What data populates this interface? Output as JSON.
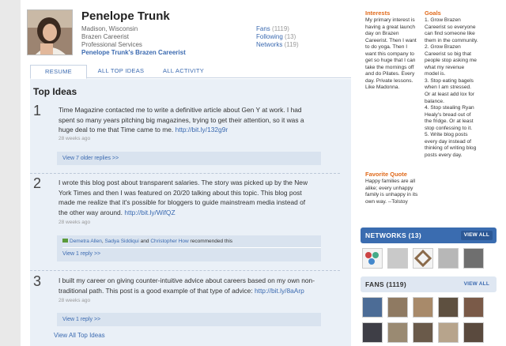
{
  "profile": {
    "name": "Penelope Trunk",
    "location": "Madison, Wisconsin",
    "company": "Brazen Careerist",
    "industry": "Professional Services",
    "blog_link": "Penelope Trunk's Brazen Careerist"
  },
  "stats": [
    {
      "label": "Fans",
      "count": "(1119)"
    },
    {
      "label": "Following",
      "count": "(13)"
    },
    {
      "label": "Networks",
      "count": "(119)"
    }
  ],
  "tabs": [
    "RESUME",
    "ALL TOP IDEAS",
    "ALL ACTIVITY"
  ],
  "section_title": "Top Ideas",
  "ideas": [
    {
      "num": "1",
      "text": "Time Magazine contacted me to write a definitive article about Gen Y at work. I had spent so many years pitching big magazines, trying to get their attention, so it was a huge deal to me that Time came to me.",
      "link": "http://bit.ly/132g9r",
      "ago": "28 weeks ago",
      "replies": "View 7 older replies >>"
    },
    {
      "num": "2",
      "text": "I wrote this blog post about transparent salaries. The story was picked up by the New York Times and then I was featured on 20/20 talking about this topic. This blog post made me realize that it's possible for bloggers to guide mainstream media instead of the other way around.",
      "link": "http://bit.ly/WifQZ",
      "ago": "28 weeks ago",
      "rec_names": [
        "Demetra Allen",
        "Sadya Siddiqui",
        "Christopher How"
      ],
      "rec_sep1": ",",
      "rec_and": "and",
      "rec_suffix": "recommended this",
      "replies": "View 1 reply >>"
    },
    {
      "num": "3",
      "text": "I built my career on giving counter-intuitive advice about careers based on my own non-traditional path. This post is a good example of that type of advice:",
      "link": "http://bit.ly/8aArp",
      "ago": "28 weeks ago",
      "replies": "View 1 reply >>"
    }
  ],
  "view_all_ideas": "View All Top Ideas",
  "interests": {
    "title": "Interests",
    "lines": [
      "My primary interest is",
      "having a great launch",
      "day on Brazen",
      "Careerist. Then I want",
      "to do yoga. Then I",
      "want this company to",
      "get so huge that I can",
      "take the mornings off",
      "and do Pilates. Every",
      "day. Private lessons.",
      "Like Madonna."
    ]
  },
  "goals": {
    "title": "Goals",
    "lines": [
      "1. Grow Brazen",
      "Careerist so everyone",
      "can find someone like",
      "them in the community.",
      "2. Grow Brazen",
      "Careerist so big that",
      "people stop asking me",
      "what my revenue",
      "model is.",
      "3. Stop eating bagels",
      "when I am stressed.",
      "Or at least add lox for",
      "balance.",
      "4. Stop stealing Ryan",
      "Healy's bread out of",
      "the fridge. Or at least",
      "stop confessing to it.",
      "5. Write blog posts",
      "every day instead of",
      "thinking of writing blog",
      "posts every day."
    ]
  },
  "quote": {
    "title": "Favorite Quote",
    "lines": [
      "Happy families are all",
      "alike; every unhappy",
      "family is unhappy in its",
      "own way. --Tolstoy"
    ]
  },
  "networks_widget": {
    "title": "NETWORKS (13)",
    "button": "VIEW ALL"
  },
  "fans_widget": {
    "title": "FANS (1119)",
    "button": "VIEW ALL"
  },
  "colors": {
    "accent": "#3a6cb0",
    "link": "#3b6ab0",
    "heading_orange": "#e06a1b",
    "content_bg": "#eaf0f7"
  }
}
